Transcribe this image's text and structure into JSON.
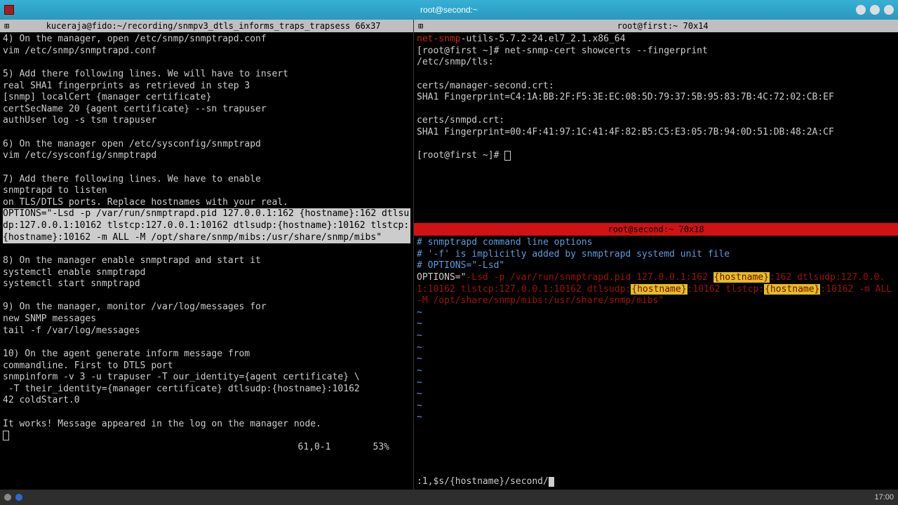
{
  "window": {
    "title": "root@second:~"
  },
  "left": {
    "title": "kuceraja@fido:~/recording/snmpv3_dtls_informs_traps_trapsess 66x37",
    "lines": [
      "4) On the manager, open /etc/snmp/snmptrapd.conf",
      "vim /etc/snmp/snmptrapd.conf",
      "",
      "5) Add there following lines. We will have to insert",
      "real SHA1 fingerprints as retrieved in step 3",
      "[snmp] localCert {manager certificate}",
      "certSecName 20 {agent certificate} --sn trapuser",
      "authUser log -s tsm trapuser",
      "",
      "6) On the manager open /etc/sysconfig/snmptrapd",
      "vim /etc/sysconfig/snmptrapd",
      "",
      "7) Add there following lines. We have to enable",
      "snmptrapd to listen",
      "on TLS/DTLS ports. Replace hostnames with your real."
    ],
    "highlight": "OPTIONS=\"-Lsd -p /var/run/snmptrapd.pid 127.0.0.1:162 {hostname}:162 dtlsudp:127.0.0.1:10162 tlstcp:127.0.0.1:10162 dtlsudp:{hostname}:10162 tlstcp:{hostname}:10162 -m ALL -M /opt/share/snmp/mibs:/usr/share/snmp/mibs\"",
    "lines2": [
      "",
      "8) On the manager enable snmptrapd and start it",
      "systemctl enable snmptrapd",
      "systemctl start snmptrapd",
      "",
      "9) On the manager, monitor /var/log/messages for",
      "new SNMP messages",
      "tail -f /var/log/messages",
      "",
      "10) On the agent generate inform message from",
      "commandline. First to DTLS port",
      "snmpinform -v 3 -u trapuser -T our_identity={agent certificate} \\",
      " -T their_identity={manager certificate} dtlsudp:{hostname}:10162",
      "42 coldStart.0",
      "",
      "It works! Message appeared in the log on the manager node."
    ],
    "status_pos": "61,0-1",
    "status_pct": "53%"
  },
  "rtop": {
    "title": "root@first:~ 70x14",
    "pkg_red": "net-snmp",
    "pkg_rest": "-utils-5.7.2-24.el7_2.1.x86_64",
    "prompt": "[root@first ~]# ",
    "cmd": "net-snmp-cert showcerts --fingerprint",
    "path": "/etc/snmp/tls:",
    "c1": "certs/manager-second.crt:",
    "f1": "SHA1 Fingerprint=C4:1A:BB:2F:F5:3E:EC:08:5D:79:37:5B:95:83:7B:4C:72:02:CB:EF",
    "c2": "certs/snmpd.crt:",
    "f2": "SHA1 Fingerprint=00:4F:41:97:1C:41:4F:82:B5:C5:E3:05:7B:94:0D:51:DB:48:2A:CF",
    "prompt2": "[root@first ~]# "
  },
  "rbot": {
    "title": "root@second:~ 70x18",
    "c1": "# snmptrapd command line options",
    "c2": "# '-f' is implicitly added by snmptrapd systemd unit file",
    "c3": "# OPTIONS=\"-Lsd\"",
    "opt_pre": "OPTIONS=\"",
    "seg1": "-Lsd -p /var/run/snmptrapd.pid 127.0.0.1:162 ",
    "hn": "{hostname}",
    "seg2": ":162 dtlsudp:127.0.0.1:10162 tlstcp:127.0.0.1:10162 dtlsudp:",
    "seg3": ":10162 tlstcp:",
    "seg4": ":10162 -m ALL -M /opt/share/snmp/mibs:/usr/share/snmp/mibs\"",
    "cmd": ":1,$s/{hostname}/second/"
  },
  "taskbar": {
    "time": "17:00"
  }
}
